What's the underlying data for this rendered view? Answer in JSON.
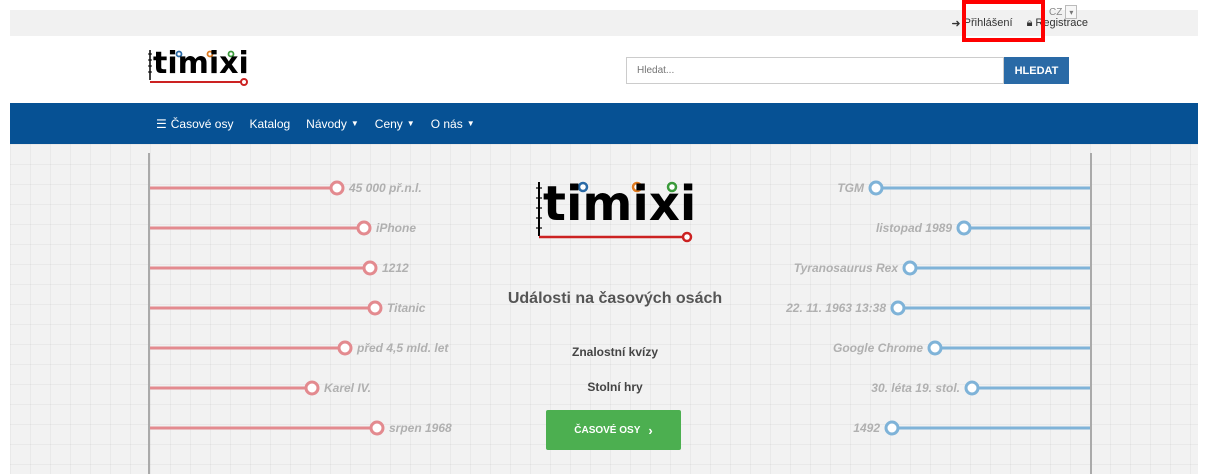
{
  "topbar": {
    "login_label": "Přihlášení",
    "register_label": "Registrace",
    "language": "CZ"
  },
  "header": {
    "logo_text": "timixi",
    "search_placeholder": "Hledat...",
    "search_button": "HLEDAT"
  },
  "nav": {
    "items": [
      {
        "label": "Časové osy",
        "icon": "timeline-icon",
        "dropdown": false
      },
      {
        "label": "Katalog",
        "dropdown": false
      },
      {
        "label": "Návody",
        "dropdown": true
      },
      {
        "label": "Ceny",
        "dropdown": true
      },
      {
        "label": "O nás",
        "dropdown": true
      }
    ]
  },
  "hero": {
    "logo_text": "timixi",
    "title": "Události na časových osách",
    "link_quiz": "Znalostní kvízy",
    "link_games": "Stolní hry",
    "cta_label": "ČASOVÉ OSY",
    "left_events": [
      "45 000 př.n.l.",
      "iPhone",
      "1212",
      "Titanic",
      "před 4,5 mld. let",
      "Karel IV.",
      "srpen 1968"
    ],
    "right_events": [
      "TGM",
      "listopad 1989",
      "Tyranosaurus Rex",
      "22. 11. 1963 13:38",
      "Google Chrome",
      "30. léta 19. stol.",
      "1492"
    ]
  },
  "colors": {
    "navbar": "#065194",
    "search_button": "#2a6aa6",
    "cta": "#4caf50",
    "left_timeline": "#e38a8f",
    "right_timeline": "#7fb3d8",
    "highlight": "#ff0000"
  }
}
